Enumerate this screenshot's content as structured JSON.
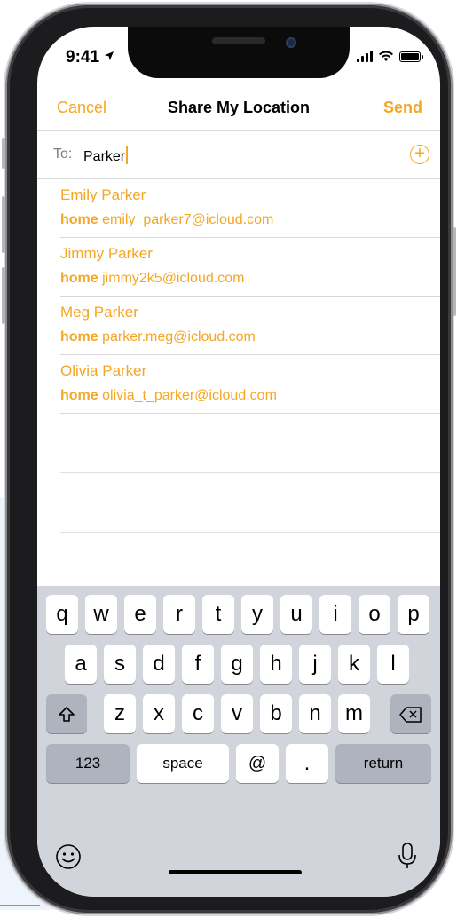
{
  "status_bar": {
    "time": "9:41"
  },
  "nav": {
    "cancel_label": "Cancel",
    "title": "Share My Location",
    "send_label": "Send"
  },
  "to_field": {
    "label": "To:",
    "value": "Parker"
  },
  "contacts": [
    {
      "name": "Emily Parker",
      "kind": "home",
      "email": "emily_parker7@icloud.com"
    },
    {
      "name": "Jimmy Parker",
      "kind": "home",
      "email": "jimmy2k5@icloud.com"
    },
    {
      "name": "Meg Parker",
      "kind": "home",
      "email": "parker.meg@icloud.com"
    },
    {
      "name": "Olivia Parker",
      "kind": "home",
      "email": "olivia_t_parker@icloud.com"
    }
  ],
  "keyboard": {
    "row1": [
      "q",
      "w",
      "e",
      "r",
      "t",
      "y",
      "u",
      "i",
      "o",
      "p"
    ],
    "row2": [
      "a",
      "s",
      "d",
      "f",
      "g",
      "h",
      "j",
      "k",
      "l"
    ],
    "row3": [
      "z",
      "x",
      "c",
      "v",
      "b",
      "n",
      "m"
    ],
    "numbers_label": "123",
    "space_label": "space",
    "at_label": "@",
    "period_label": ".",
    "return_label": "return"
  },
  "icons": {
    "location": "location-arrow-icon",
    "signal": "cellular-signal-icon",
    "wifi": "wifi-icon",
    "battery": "battery-icon",
    "add": "plus-circle-icon",
    "shift": "shift-icon",
    "delete": "delete-icon",
    "emoji": "emoji-icon",
    "mic": "microphone-icon"
  },
  "colors": {
    "accent": "#f5a623",
    "keyboard_bg": "#d1d4da",
    "special_key": "#aeb3be"
  }
}
